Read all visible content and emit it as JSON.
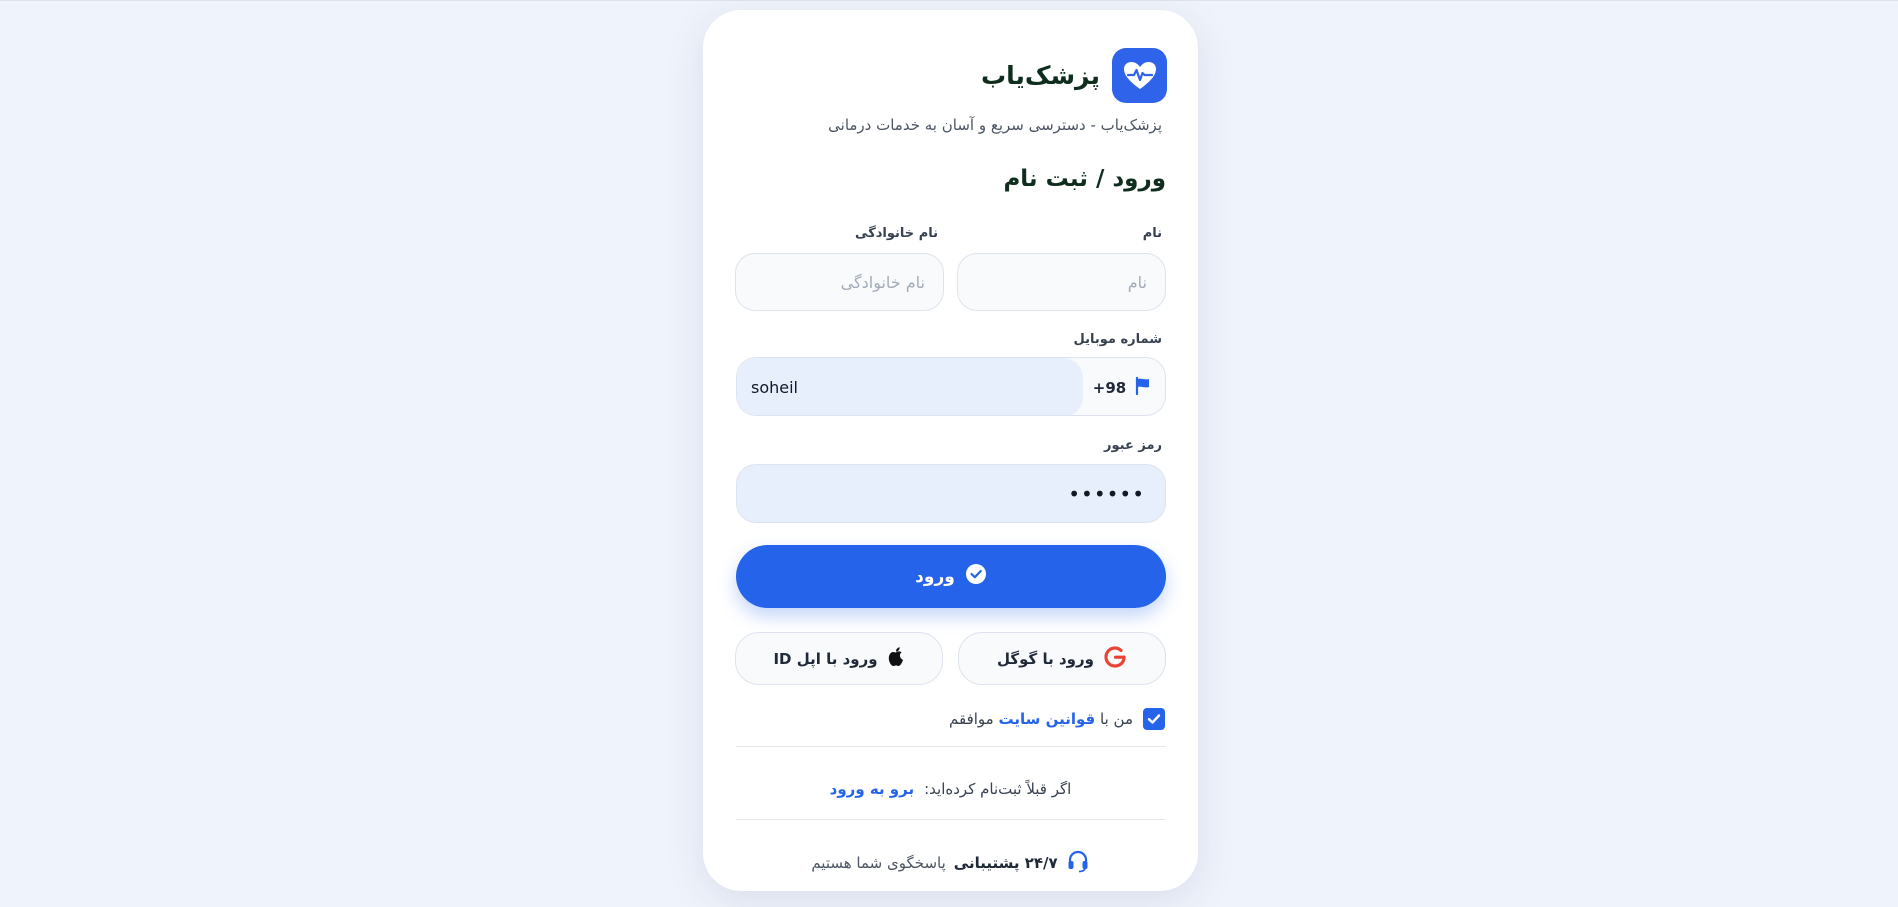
{
  "brand": {
    "name": "پزشک‌یاب",
    "tagline": "پزشک‌یاب - دسترسی سریع و آسان به خدمات درمانی",
    "logo_icon": "heart-pulse-icon",
    "accent_color": "#2f63ea"
  },
  "form": {
    "heading": "ورود / ثبت نام",
    "first_name": {
      "label": "نام",
      "placeholder": "نام",
      "value": ""
    },
    "last_name": {
      "label": "نام خانوادگی",
      "placeholder": "نام خانوادگی",
      "value": ""
    },
    "mobile": {
      "label": "شماره موبایل",
      "country_code": "+98",
      "flag_icon": "flag-icon",
      "value": "soheil"
    },
    "password": {
      "label": "رمز عبور",
      "value": "••••••"
    },
    "submit_label": "ورود",
    "submit_icon": "check-circle-icon",
    "primary_color": "#2563eb"
  },
  "social": {
    "google_label": "ورود با گوگل",
    "apple_label": "ورود با اپل ID"
  },
  "terms": {
    "checked": true,
    "prefix": "من با",
    "link": "قوانین سایت",
    "suffix": "موافقم"
  },
  "login_prompt": {
    "text": "اگر قبلاً ثبت‌نام کرده‌اید:",
    "link": "برو به ورود"
  },
  "support": {
    "icon": "headset-icon",
    "strong": "۲۴/۷ پشتیبانی",
    "text": "پاسخگوی شما هستیم"
  }
}
